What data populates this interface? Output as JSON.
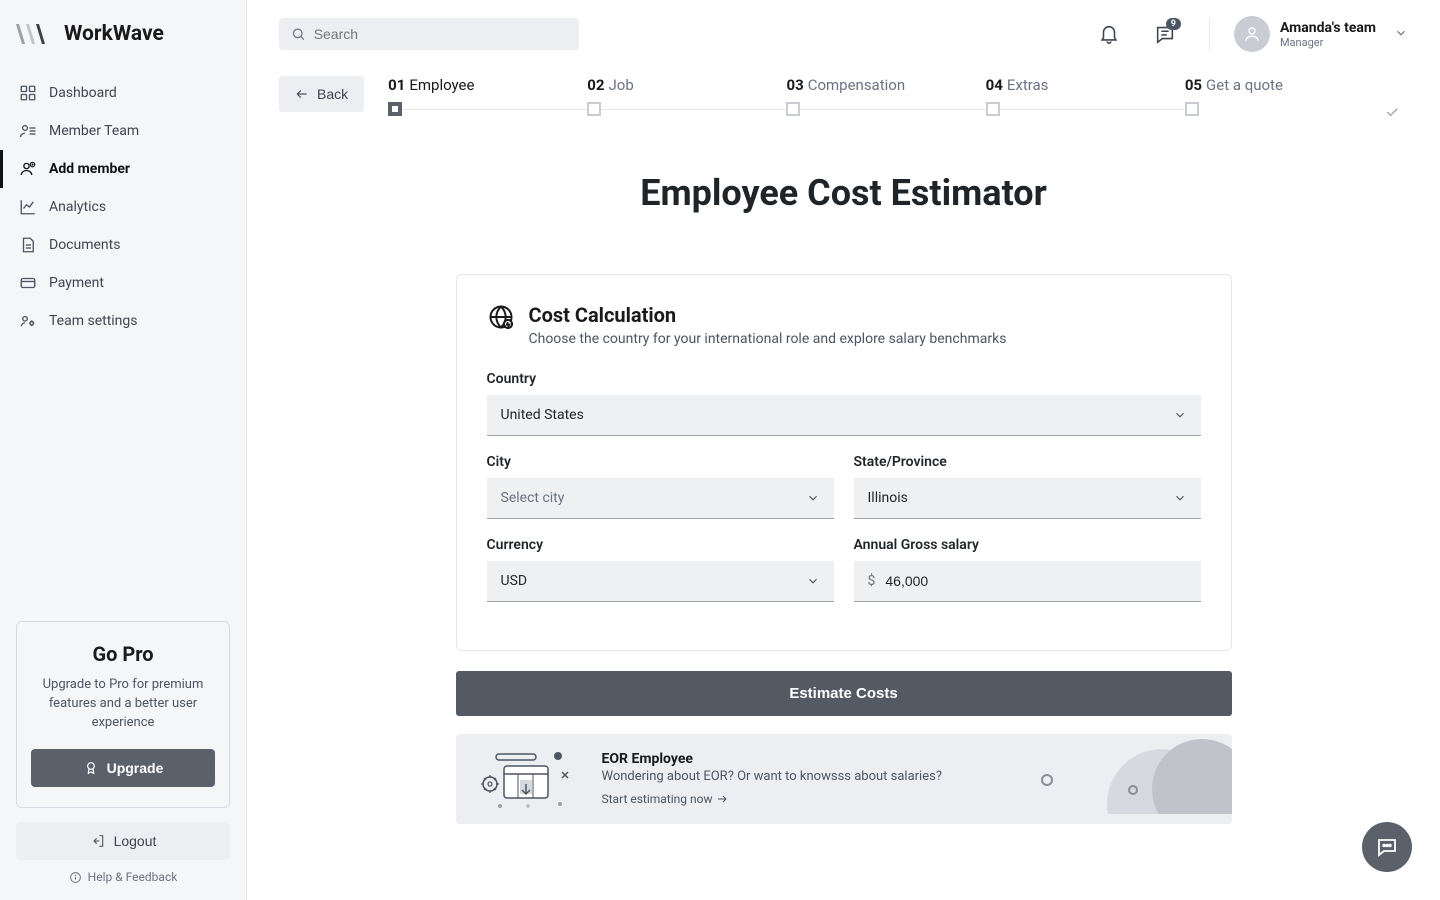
{
  "brand": "WorkWave",
  "search_placeholder": "Search",
  "messages_badge": "9",
  "team": {
    "name": "Amanda's team",
    "role": "Manager"
  },
  "sidebar": {
    "items": [
      {
        "label": "Dashboard"
      },
      {
        "label": "Member Team"
      },
      {
        "label": "Add member"
      },
      {
        "label": "Analytics"
      },
      {
        "label": "Documents"
      },
      {
        "label": "Payment"
      },
      {
        "label": "Team settings"
      }
    ],
    "upgrade": {
      "title": "Go Pro",
      "desc": "Upgrade to Pro for premium features and a better user experience",
      "button": "Upgrade"
    },
    "logout": "Logout",
    "help": "Help & Feedback"
  },
  "back": "Back",
  "steps": [
    {
      "num": "01",
      "label": "Employee"
    },
    {
      "num": "02",
      "label": "Job"
    },
    {
      "num": "03",
      "label": "Compensation"
    },
    {
      "num": "04",
      "label": "Extras"
    },
    {
      "num": "05",
      "label": "Get a quote"
    }
  ],
  "page_title": "Employee Cost Estimator",
  "card": {
    "title": "Cost Calculation",
    "sub": "Choose the country for your international role and explore salary benchmarks",
    "fields": {
      "country": {
        "label": "Country",
        "value": "United States"
      },
      "city": {
        "label": "City",
        "value": "Select city"
      },
      "state": {
        "label": "State/Province",
        "value": "Illinois"
      },
      "currency": {
        "label": "Currency",
        "value": "USD"
      },
      "salary": {
        "label": "Annual Gross salary",
        "symbol": "$",
        "value": "46,000"
      }
    }
  },
  "estimate_btn": "Estimate Costs",
  "promo": {
    "title": "EOR Employee",
    "sub": "Wondering about EOR? Or want to knowsss about salaries?",
    "link": "Start estimating now"
  }
}
